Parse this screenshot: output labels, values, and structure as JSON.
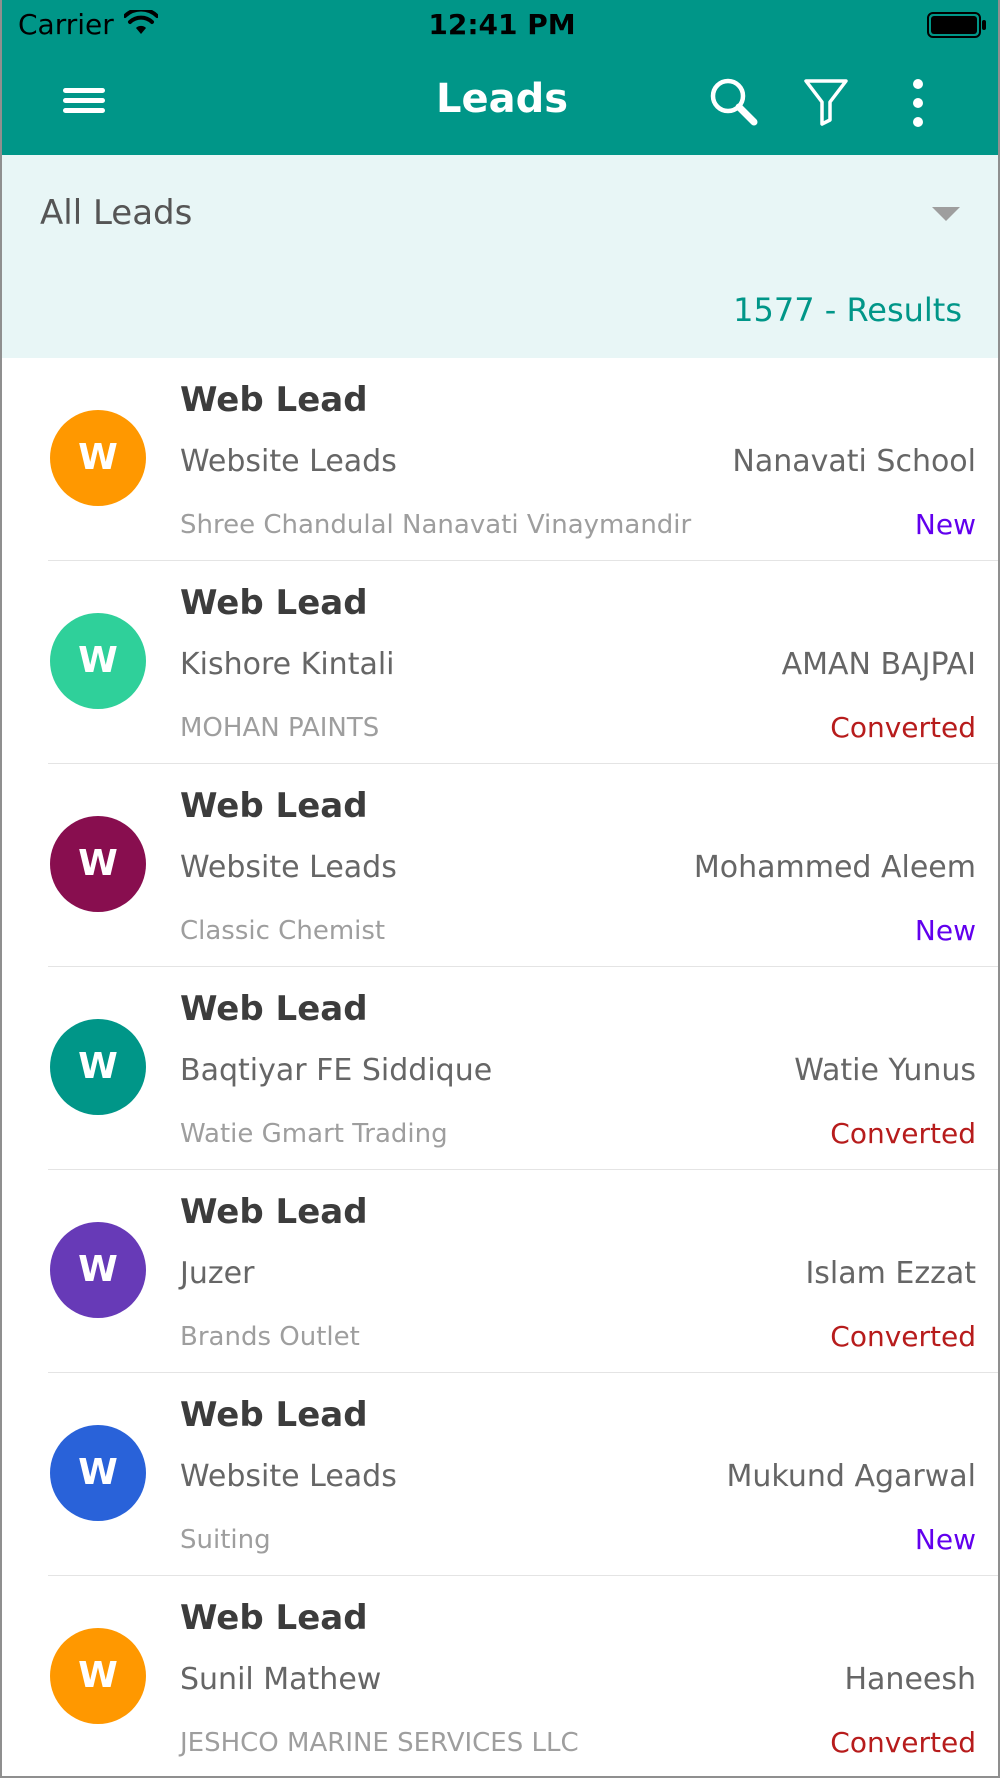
{
  "status_bar": {
    "carrier": "Carrier",
    "time": "12:41 PM"
  },
  "header": {
    "title": "Leads"
  },
  "filter": {
    "selected": "All Leads",
    "results": "1577 - Results"
  },
  "colors": {
    "primary": "#009688",
    "panel": "#e8f6f6",
    "status_new": "#6200ee",
    "status_converted": "#b71c1c"
  },
  "leads": [
    {
      "initial": "W",
      "avatar_color": "#ff9800",
      "title": "Web Lead",
      "name": "Website Leads",
      "owner": "Nanavati School",
      "company": "Shree Chandulal Nanavati Vinaymandir",
      "status": "New",
      "status_color": "#6200ee"
    },
    {
      "initial": "W",
      "avatar_color": "#2fd09a",
      "title": "Web Lead",
      "name": "Kishore Kintali",
      "owner": "AMAN BAJPAI",
      "company": "MOHAN PAINTS",
      "status": "Converted",
      "status_color": "#b71c1c"
    },
    {
      "initial": "W",
      "avatar_color": "#880e4f",
      "title": "Web Lead",
      "name": "Website Leads",
      "owner": "Mohammed Aleem",
      "company": "Classic Chemist",
      "status": "New",
      "status_color": "#6200ee"
    },
    {
      "initial": "W",
      "avatar_color": "#009688",
      "title": "Web Lead",
      "name": "Baqtiyar FE Siddique",
      "owner": "Watie Yunus",
      "company": "Watie Gmart Trading",
      "status": "Converted",
      "status_color": "#b71c1c"
    },
    {
      "initial": "W",
      "avatar_color": "#673ab7",
      "title": "Web Lead",
      "name": "Juzer",
      "owner": "Islam Ezzat",
      "company": "Brands Outlet",
      "status": "Converted",
      "status_color": "#b71c1c"
    },
    {
      "initial": "W",
      "avatar_color": "#2962d9",
      "title": "Web Lead",
      "name": "Website Leads",
      "owner": "Mukund Agarwal",
      "company": "Suiting",
      "status": "New",
      "status_color": "#6200ee"
    },
    {
      "initial": "W",
      "avatar_color": "#ff9800",
      "title": "Web Lead",
      "name": "Sunil Mathew",
      "owner": "Haneesh",
      "company": "JESHCO MARINE SERVICES LLC",
      "status": "Converted",
      "status_color": "#b71c1c"
    }
  ]
}
